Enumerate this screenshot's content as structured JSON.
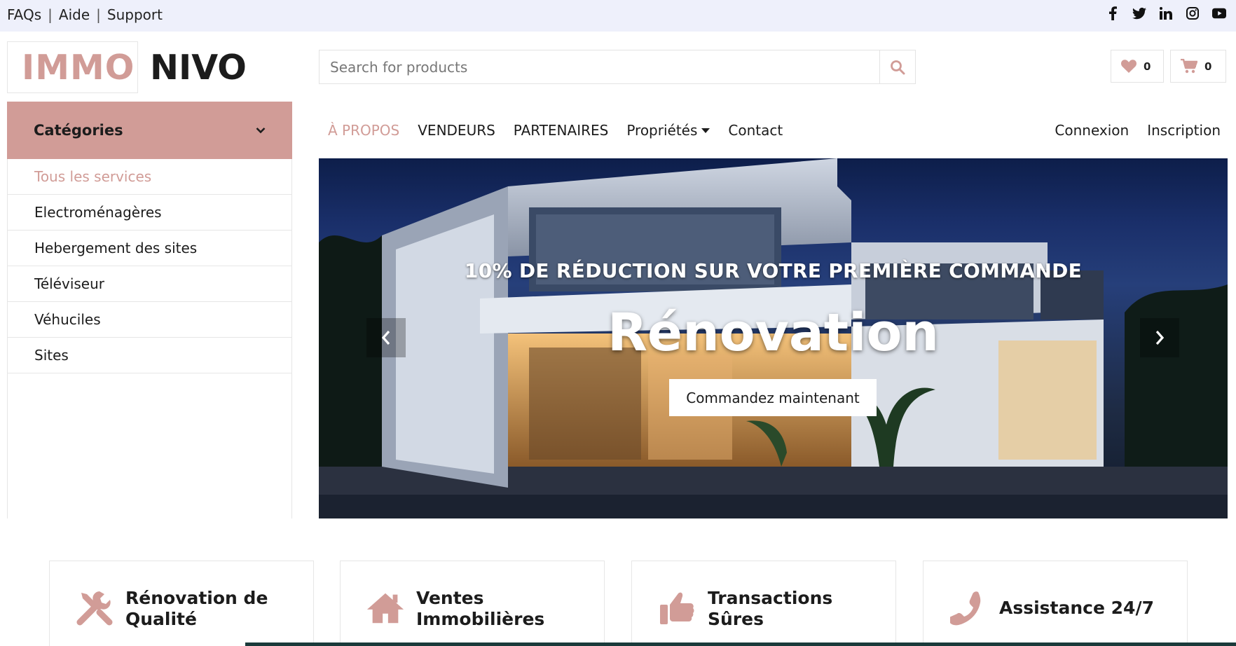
{
  "topbar": {
    "links": [
      "FAQs",
      "Aide",
      "Support"
    ],
    "social_icons": [
      "facebook-icon",
      "twitter-icon",
      "linkedin-icon",
      "instagram-icon",
      "youtube-icon"
    ]
  },
  "logo": {
    "part1": "IMMO",
    "part2": "NIVO"
  },
  "search": {
    "placeholder": "Search for products"
  },
  "header": {
    "wishlist_count": "0",
    "cart_count": "0"
  },
  "categories": {
    "title": "Catégories",
    "items": [
      "Tous les services",
      "Electroménagères",
      "Hebergement des sites",
      "Téléviseur",
      "Véhuciles",
      "Sites"
    ]
  },
  "nav": {
    "items": [
      "À PROPOS",
      "VENDEURS",
      "PARTENAIRES",
      "Propriétés",
      "Contact"
    ],
    "right": [
      "Connexion",
      "Inscription"
    ]
  },
  "hero": {
    "subtitle": "10% DE RÉDUCTION SUR VOTRE PREMIÈRE COMMANDE",
    "title": "Rénovation",
    "cta": "Commandez maintenant"
  },
  "features": [
    {
      "label": "Rénovation de Qualité",
      "icon": "tools-icon"
    },
    {
      "label": "Ventes Immobilières",
      "icon": "home-icon"
    },
    {
      "label": "Transactions Sûres",
      "icon": "thumbs-up-icon"
    },
    {
      "label": "Assistance 24/7",
      "icon": "phone-icon"
    }
  ],
  "colors": {
    "accent": "#d19c97",
    "topbar": "#eef0fb",
    "text": "#1c1c1c"
  }
}
